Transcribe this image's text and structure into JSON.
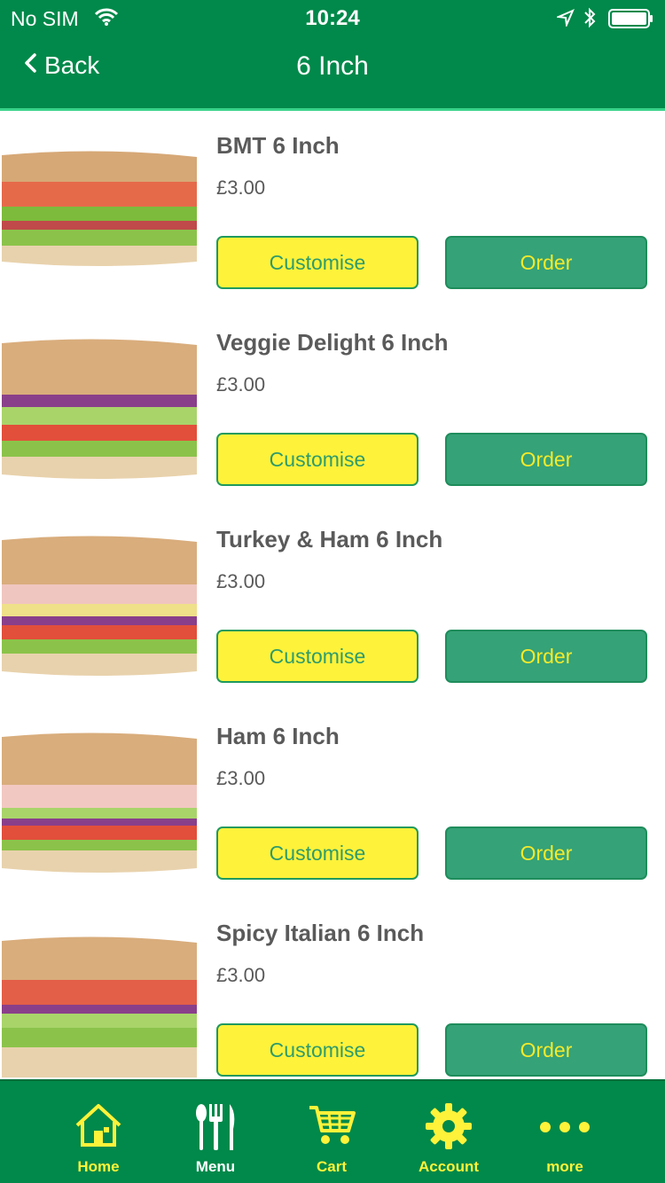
{
  "status_bar": {
    "carrier": "No SIM",
    "time": "10:24"
  },
  "nav": {
    "back_label": "Back",
    "title": "6 Inch"
  },
  "items": [
    {
      "name": "BMT 6 Inch",
      "price": "£3.00",
      "customise_label": "Customise",
      "order_label": "Order"
    },
    {
      "name": "Veggie Delight 6 Inch",
      "price": "£3.00",
      "customise_label": "Customise",
      "order_label": "Order"
    },
    {
      "name": "Turkey & Ham 6 Inch",
      "price": "£3.00",
      "customise_label": "Customise",
      "order_label": "Order"
    },
    {
      "name": "Ham 6 Inch",
      "price": "£3.00",
      "customise_label": "Customise",
      "order_label": "Order"
    },
    {
      "name": "Spicy Italian 6 Inch",
      "price": "£3.00",
      "customise_label": "Customise",
      "order_label": "Order"
    }
  ],
  "tabbar": {
    "tabs": [
      {
        "label": "Home",
        "icon": "home-icon",
        "active": true
      },
      {
        "label": "Menu",
        "icon": "cutlery-icon",
        "active": false
      },
      {
        "label": "Cart",
        "icon": "cart-icon",
        "active": false
      },
      {
        "label": "Account",
        "icon": "gear-icon",
        "active": false
      },
      {
        "label": "more",
        "icon": "more-dots-icon",
        "active": false
      }
    ]
  },
  "colors": {
    "brand_green": "#00894a",
    "accent_yellow": "#fff23a",
    "order_green": "#35a277",
    "tab_active": "#fff23a",
    "tab_inactive": "#ffffff"
  }
}
